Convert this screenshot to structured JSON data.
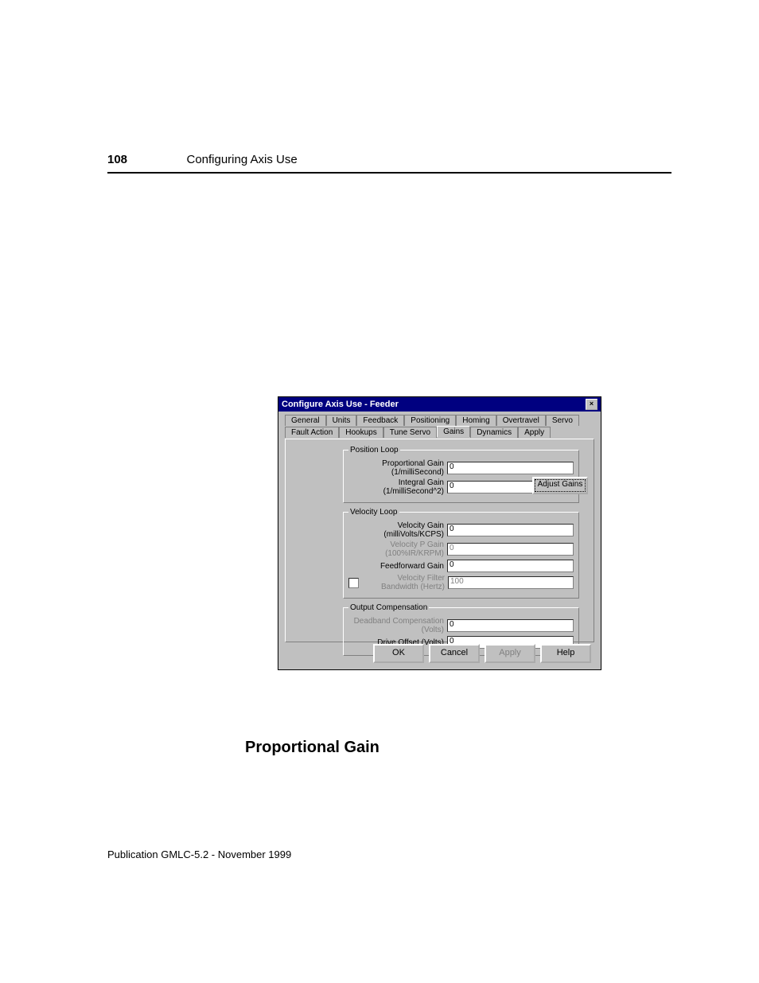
{
  "header": {
    "page_number": "108",
    "title": "Configuring Axis Use"
  },
  "section_heading": "Proportional Gain",
  "footer": "Publication GMLC-5.2 - November 1999",
  "dialog": {
    "title": "Configure Axis Use - Feeder",
    "close": "×",
    "tabs_row1": [
      "General",
      "Units",
      "Feedback",
      "Positioning",
      "Homing",
      "Overtravel",
      "Servo"
    ],
    "tabs_row2": [
      "Fault Action",
      "Hookups",
      "Tune Servo",
      "Gains",
      "Dynamics",
      "Apply"
    ],
    "active_tab": "Gains",
    "adjust_button": "Adjust Gains",
    "position_loop": {
      "legend": "Position Loop",
      "proportional_label": "Proportional Gain (1/milliSecond)",
      "proportional_value": "0",
      "integral_label": "Integral Gain (1/milliSecond^2)",
      "integral_value": "0"
    },
    "velocity_loop": {
      "legend": "Velocity Loop",
      "velocity_gain_label": "Velocity Gain (milliVolts/KCPS)",
      "velocity_gain_value": "0",
      "velocity_p_label": "Velocity P Gain (100%IR/KRPM)",
      "velocity_p_value": "0",
      "feedforward_label": "Feedforward Gain",
      "feedforward_value": "0",
      "filter_bw_label": "Velocity Filter Bandwidth (Hertz)",
      "filter_bw_value": "100"
    },
    "output_comp": {
      "legend": "Output Compensation",
      "deadband_label": "Deadband Compensation (Volts)",
      "deadband_value": "0",
      "drive_offset_label": "Drive Offset (Volts)",
      "drive_offset_value": "0"
    },
    "buttons": {
      "ok": "OK",
      "cancel": "Cancel",
      "apply": "Apply",
      "help": "Help"
    }
  }
}
